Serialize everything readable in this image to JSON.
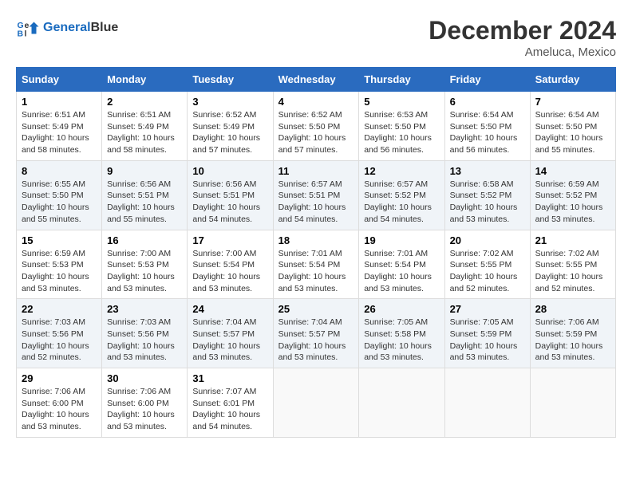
{
  "header": {
    "logo_line1": "General",
    "logo_line2": "Blue",
    "month": "December 2024",
    "location": "Ameluca, Mexico"
  },
  "weekdays": [
    "Sunday",
    "Monday",
    "Tuesday",
    "Wednesday",
    "Thursday",
    "Friday",
    "Saturday"
  ],
  "weeks": [
    [
      {
        "day": "1",
        "sunrise": "6:51 AM",
        "sunset": "5:49 PM",
        "daylight": "10 hours and 58 minutes."
      },
      {
        "day": "2",
        "sunrise": "6:51 AM",
        "sunset": "5:49 PM",
        "daylight": "10 hours and 58 minutes."
      },
      {
        "day": "3",
        "sunrise": "6:52 AM",
        "sunset": "5:49 PM",
        "daylight": "10 hours and 57 minutes."
      },
      {
        "day": "4",
        "sunrise": "6:52 AM",
        "sunset": "5:50 PM",
        "daylight": "10 hours and 57 minutes."
      },
      {
        "day": "5",
        "sunrise": "6:53 AM",
        "sunset": "5:50 PM",
        "daylight": "10 hours and 56 minutes."
      },
      {
        "day": "6",
        "sunrise": "6:54 AM",
        "sunset": "5:50 PM",
        "daylight": "10 hours and 56 minutes."
      },
      {
        "day": "7",
        "sunrise": "6:54 AM",
        "sunset": "5:50 PM",
        "daylight": "10 hours and 55 minutes."
      }
    ],
    [
      {
        "day": "8",
        "sunrise": "6:55 AM",
        "sunset": "5:50 PM",
        "daylight": "10 hours and 55 minutes."
      },
      {
        "day": "9",
        "sunrise": "6:56 AM",
        "sunset": "5:51 PM",
        "daylight": "10 hours and 55 minutes."
      },
      {
        "day": "10",
        "sunrise": "6:56 AM",
        "sunset": "5:51 PM",
        "daylight": "10 hours and 54 minutes."
      },
      {
        "day": "11",
        "sunrise": "6:57 AM",
        "sunset": "5:51 PM",
        "daylight": "10 hours and 54 minutes."
      },
      {
        "day": "12",
        "sunrise": "6:57 AM",
        "sunset": "5:52 PM",
        "daylight": "10 hours and 54 minutes."
      },
      {
        "day": "13",
        "sunrise": "6:58 AM",
        "sunset": "5:52 PM",
        "daylight": "10 hours and 53 minutes."
      },
      {
        "day": "14",
        "sunrise": "6:59 AM",
        "sunset": "5:52 PM",
        "daylight": "10 hours and 53 minutes."
      }
    ],
    [
      {
        "day": "15",
        "sunrise": "6:59 AM",
        "sunset": "5:53 PM",
        "daylight": "10 hours and 53 minutes."
      },
      {
        "day": "16",
        "sunrise": "7:00 AM",
        "sunset": "5:53 PM",
        "daylight": "10 hours and 53 minutes."
      },
      {
        "day": "17",
        "sunrise": "7:00 AM",
        "sunset": "5:54 PM",
        "daylight": "10 hours and 53 minutes."
      },
      {
        "day": "18",
        "sunrise": "7:01 AM",
        "sunset": "5:54 PM",
        "daylight": "10 hours and 53 minutes."
      },
      {
        "day": "19",
        "sunrise": "7:01 AM",
        "sunset": "5:54 PM",
        "daylight": "10 hours and 53 minutes."
      },
      {
        "day": "20",
        "sunrise": "7:02 AM",
        "sunset": "5:55 PM",
        "daylight": "10 hours and 52 minutes."
      },
      {
        "day": "21",
        "sunrise": "7:02 AM",
        "sunset": "5:55 PM",
        "daylight": "10 hours and 52 minutes."
      }
    ],
    [
      {
        "day": "22",
        "sunrise": "7:03 AM",
        "sunset": "5:56 PM",
        "daylight": "10 hours and 52 minutes."
      },
      {
        "day": "23",
        "sunrise": "7:03 AM",
        "sunset": "5:56 PM",
        "daylight": "10 hours and 53 minutes."
      },
      {
        "day": "24",
        "sunrise": "7:04 AM",
        "sunset": "5:57 PM",
        "daylight": "10 hours and 53 minutes."
      },
      {
        "day": "25",
        "sunrise": "7:04 AM",
        "sunset": "5:57 PM",
        "daylight": "10 hours and 53 minutes."
      },
      {
        "day": "26",
        "sunrise": "7:05 AM",
        "sunset": "5:58 PM",
        "daylight": "10 hours and 53 minutes."
      },
      {
        "day": "27",
        "sunrise": "7:05 AM",
        "sunset": "5:59 PM",
        "daylight": "10 hours and 53 minutes."
      },
      {
        "day": "28",
        "sunrise": "7:06 AM",
        "sunset": "5:59 PM",
        "daylight": "10 hours and 53 minutes."
      }
    ],
    [
      {
        "day": "29",
        "sunrise": "7:06 AM",
        "sunset": "6:00 PM",
        "daylight": "10 hours and 53 minutes."
      },
      {
        "day": "30",
        "sunrise": "7:06 AM",
        "sunset": "6:00 PM",
        "daylight": "10 hours and 53 minutes."
      },
      {
        "day": "31",
        "sunrise": "7:07 AM",
        "sunset": "6:01 PM",
        "daylight": "10 hours and 54 minutes."
      },
      null,
      null,
      null,
      null
    ]
  ],
  "labels": {
    "sunrise": "Sunrise:",
    "sunset": "Sunset:",
    "daylight": "Daylight:"
  }
}
